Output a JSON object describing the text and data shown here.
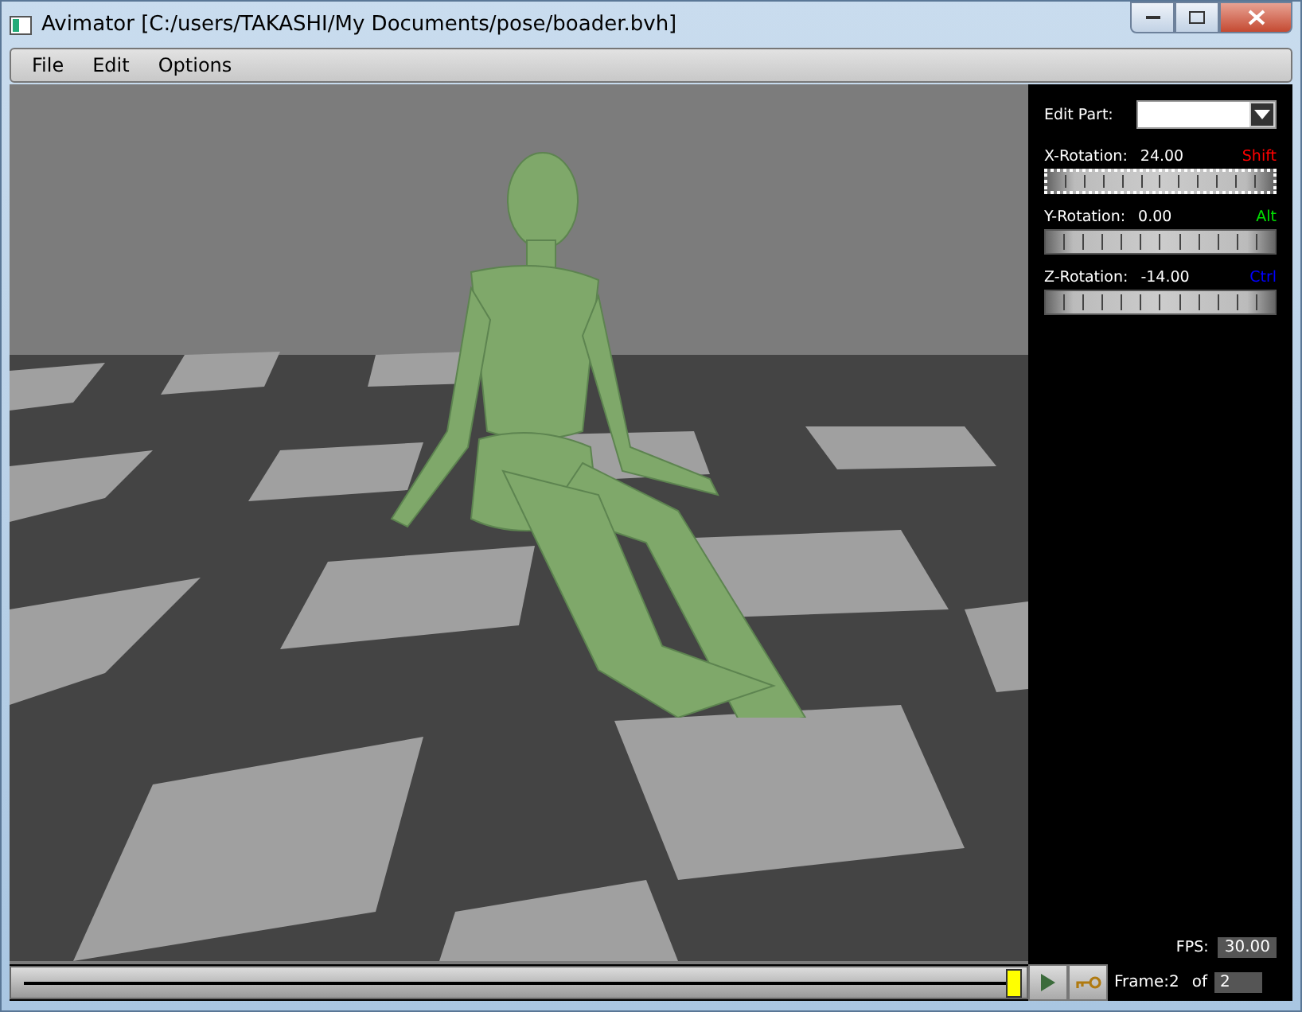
{
  "window": {
    "title": "Avimator [C:/users/TAKASHI/My Documents/pose/boader.bvh]"
  },
  "menu": [
    "File",
    "Edit",
    "Options"
  ],
  "panel": {
    "edit_part_label": "Edit Part:",
    "rotations": [
      {
        "label": "X-Rotation:",
        "value": "24.00",
        "modifier": "Shift",
        "color": "#ff0000",
        "selected": true
      },
      {
        "label": "Y-Rotation:",
        "value": "0.00",
        "modifier": "Alt",
        "color": "#00e000",
        "selected": false
      },
      {
        "label": "Z-Rotation:",
        "value": "-14.00",
        "modifier": "Ctrl",
        "color": "#0000ff",
        "selected": false
      }
    ],
    "fps_label": "FPS:",
    "fps": "30.00"
  },
  "timeline": {
    "level": 1.0,
    "frame_label": "Frame:",
    "frame": "2",
    "of_label": "of",
    "total": "2"
  }
}
